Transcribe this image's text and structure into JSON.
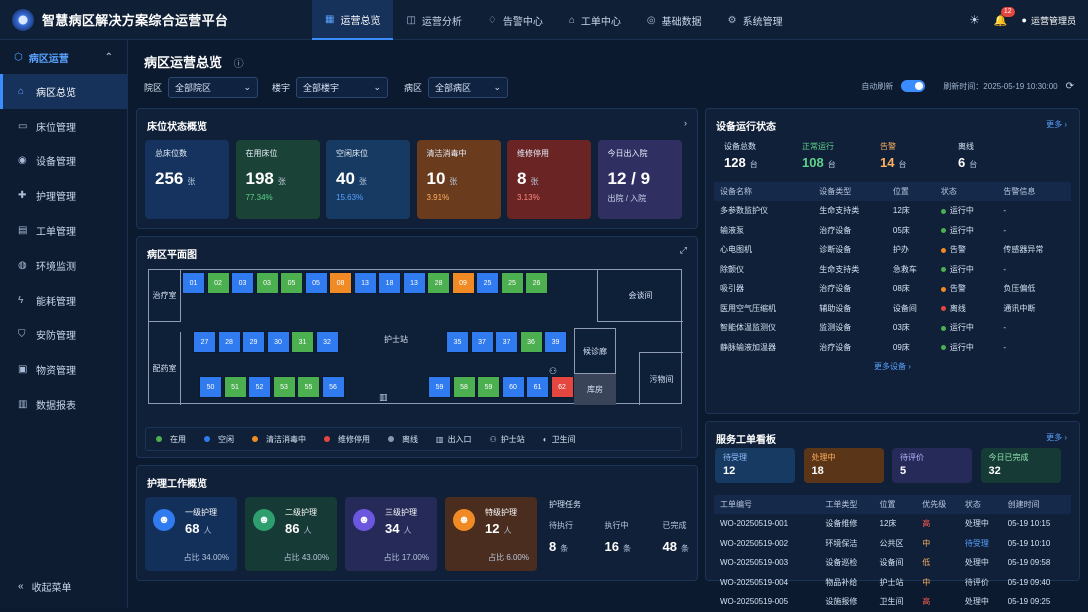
{
  "app": {
    "title": "智慧病区解决方案综合运营平台"
  },
  "topnav": [
    {
      "label": "运营总览",
      "icon": "grid-icon",
      "active": true
    },
    {
      "label": "运营分析",
      "icon": "chart-icon"
    },
    {
      "label": "告警中心",
      "icon": "bell-icon"
    },
    {
      "label": "工单中心",
      "icon": "home-icon"
    },
    {
      "label": "基础数据",
      "icon": "database-icon"
    },
    {
      "label": "系统管理",
      "icon": "gear-icon"
    }
  ],
  "header": {
    "notif_count": "12",
    "user": "运营管理员"
  },
  "sidebar": {
    "group": "病区运营",
    "items": [
      {
        "label": "病区总览",
        "icon": "home-icon",
        "active": true
      },
      {
        "label": "床位管理",
        "icon": "bed-icon"
      },
      {
        "label": "设备管理",
        "icon": "device-icon"
      },
      {
        "label": "护理管理",
        "icon": "care-icon"
      },
      {
        "label": "工单管理",
        "icon": "ticket-icon"
      },
      {
        "label": "环境监测",
        "icon": "env-icon"
      },
      {
        "label": "能耗管理",
        "icon": "energy-icon"
      },
      {
        "label": "安防管理",
        "icon": "shield-icon"
      },
      {
        "label": "物资管理",
        "icon": "box-icon"
      },
      {
        "label": "数据报表",
        "icon": "report-icon"
      }
    ],
    "collapse": "收起菜单"
  },
  "page": {
    "title": "病区运营总览"
  },
  "filters": {
    "campus_label": "院区",
    "campus_value": "全部院区",
    "building_label": "楼宇",
    "building_value": "全部楼宇",
    "ward_label": "病区",
    "ward_value": "全部病区",
    "auto_refresh": "自动刷新",
    "refresh_time": "刷新时间：2025-05-19 10:30:00"
  },
  "bed_status": {
    "title": "床位状态概览",
    "cards": [
      {
        "label": "总床位数",
        "value": "256",
        "unit": "张",
        "sub": "",
        "color": "#15335e",
        "subcolor": "#5aa2ff"
      },
      {
        "label": "在用床位",
        "value": "198",
        "unit": "张",
        "sub": "77.34%",
        "color": "#1b4236",
        "subcolor": "#5fd38a"
      },
      {
        "label": "空闲床位",
        "value": "40",
        "unit": "张",
        "sub": "15.63%",
        "color": "#173a62",
        "subcolor": "#5aa2ff"
      },
      {
        "label": "清洁消毒中",
        "value": "10",
        "unit": "张",
        "sub": "3.91%",
        "color": "#6a3b1c",
        "subcolor": "#ffb060"
      },
      {
        "label": "维修停用",
        "value": "8",
        "unit": "张",
        "sub": "3.13%",
        "color": "#6a2424",
        "subcolor": "#ff8a80"
      },
      {
        "label": "今日出入院",
        "value": "12 / 9",
        "unit": "",
        "sub": "出院 / 入院",
        "color": "#2f2f62",
        "subcolor": "#c9d6ea"
      }
    ]
  },
  "floorplan": {
    "title": "病区平面图",
    "rooms": {
      "treatment": "治疗室",
      "dispensary": "配药室",
      "nurse_station": "护士站",
      "reception": "会谈间",
      "corridor": "候诊廊",
      "storeroom": "库房",
      "dirty": "污物间"
    },
    "row1": [
      {
        "n": "01",
        "s": "idle"
      },
      {
        "n": "02",
        "s": "use"
      },
      {
        "n": "03",
        "s": "idle"
      },
      {
        "n": "03",
        "s": "use"
      },
      {
        "n": "05",
        "s": "use"
      },
      {
        "n": "05",
        "s": "idle"
      },
      {
        "n": "08",
        "s": "clean"
      },
      {
        "n": "13",
        "s": "idle"
      },
      {
        "n": "18",
        "s": "idle"
      },
      {
        "n": "13",
        "s": "idle"
      },
      {
        "n": "28",
        "s": "use"
      },
      {
        "n": "09",
        "s": "clean"
      },
      {
        "n": "25",
        "s": "idle"
      },
      {
        "n": "25",
        "s": "use"
      },
      {
        "n": "26",
        "s": "use"
      }
    ],
    "row2a": [
      {
        "n": "27",
        "s": "idle"
      },
      {
        "n": "28",
        "s": "idle"
      },
      {
        "n": "29",
        "s": "idle"
      },
      {
        "n": "30",
        "s": "idle"
      },
      {
        "n": "31",
        "s": "use"
      },
      {
        "n": "32",
        "s": "idle"
      }
    ],
    "row2b": [
      {
        "n": "35",
        "s": "idle"
      },
      {
        "n": "37",
        "s": "idle"
      },
      {
        "n": "37",
        "s": "idle"
      },
      {
        "n": "36",
        "s": "use"
      },
      {
        "n": "39",
        "s": "idle"
      }
    ],
    "row3a": [
      {
        "n": "50",
        "s": "idle"
      },
      {
        "n": "51",
        "s": "use"
      },
      {
        "n": "52",
        "s": "idle"
      },
      {
        "n": "53",
        "s": "use"
      },
      {
        "n": "55",
        "s": "use"
      },
      {
        "n": "56",
        "s": "idle"
      }
    ],
    "row3b": [
      {
        "n": "59",
        "s": "idle"
      },
      {
        "n": "58",
        "s": "use"
      },
      {
        "n": "59",
        "s": "use"
      },
      {
        "n": "60",
        "s": "idle"
      },
      {
        "n": "61",
        "s": "idle"
      },
      {
        "n": "62",
        "s": "repair"
      }
    ],
    "legend": [
      {
        "label": "在用",
        "color": "#4caf50"
      },
      {
        "label": "空闲",
        "color": "#2f7bef"
      },
      {
        "label": "清洁消毒中",
        "color": "#f08a24"
      },
      {
        "label": "维修停用",
        "color": "#e5463f"
      },
      {
        "label": "离线",
        "color": "#8a97ab"
      },
      {
        "label": "出入口",
        "icon": "exit-icon"
      },
      {
        "label": "护士站",
        "icon": "nurse-icon"
      },
      {
        "label": "卫生间",
        "icon": "toilet-icon"
      }
    ]
  },
  "nursing": {
    "title": "护理工作概览",
    "cards": [
      {
        "label": "一级护理",
        "value": "68",
        "unit": "人",
        "pct": "占比 34.00%",
        "color": "#13305a",
        "iconbg": "#2f7bef"
      },
      {
        "label": "二级护理",
        "value": "86",
        "unit": "人",
        "pct": "占比 43.00%",
        "color": "#163a35",
        "iconbg": "#2f9e6f"
      },
      {
        "label": "三级护理",
        "value": "34",
        "unit": "人",
        "pct": "占比 17.00%",
        "color": "#262a58",
        "iconbg": "#6c58e0"
      },
      {
        "label": "特级护理",
        "value": "12",
        "unit": "人",
        "pct": "占比 6.00%",
        "color": "#4a2d1e",
        "iconbg": "#f08a24"
      }
    ],
    "tasks": {
      "title": "护理任务",
      "items": [
        {
          "label": "待执行",
          "value": "8",
          "unit": "条"
        },
        {
          "label": "执行中",
          "value": "16",
          "unit": "条"
        },
        {
          "label": "已完成",
          "value": "48",
          "unit": "条"
        }
      ]
    }
  },
  "devices": {
    "title": "设备运行状态",
    "more": "更多 ›",
    "stats": [
      {
        "label": "设备总数",
        "value": "128",
        "unit": "台",
        "color": "#d6e2f3",
        "valcolor": "#fff"
      },
      {
        "label": "正常运行",
        "value": "108",
        "unit": "台",
        "color": "#5fd38a",
        "valcolor": "#5fd38a"
      },
      {
        "label": "告警",
        "value": "14",
        "unit": "台",
        "color": "#ffb060",
        "valcolor": "#ffb060"
      },
      {
        "label": "离线",
        "value": "6",
        "unit": "台",
        "color": "#d6e2f3",
        "valcolor": "#fff"
      }
    ],
    "columns": [
      "设备名称",
      "设备类型",
      "位置",
      "状态",
      "告警信息"
    ],
    "rows": [
      [
        "多参数监护仪",
        "生命支持类",
        "12床",
        "运行中",
        "-"
      ],
      [
        "输液泵",
        "治疗设备",
        "05床",
        "运行中",
        "-"
      ],
      [
        "心电图机",
        "诊断设备",
        "护办",
        "告警",
        "传感器异常"
      ],
      [
        "除颤仪",
        "生命支持类",
        "急救车",
        "运行中",
        "-"
      ],
      [
        "吸引器",
        "治疗设备",
        "08床",
        "告警",
        "负压偏低"
      ],
      [
        "医用空气压缩机",
        "辅助设备",
        "设备间",
        "离线",
        "通讯中断"
      ],
      [
        "智能体温监测仪",
        "监测设备",
        "03床",
        "运行中",
        "-"
      ],
      [
        "静脉输液加温器",
        "治疗设备",
        "09床",
        "运行中",
        "-"
      ]
    ],
    "status_colors": {
      "运行中": "#4caf50",
      "告警": "#f08a24",
      "离线": "#e5463f"
    },
    "more_devices": "更多设备 ›"
  },
  "workorders": {
    "title": "服务工单看板",
    "more": "更多 ›",
    "cards": [
      {
        "label": "待受理",
        "value": "12",
        "color": "#173a62",
        "labelcolor": "#8fc0ff"
      },
      {
        "label": "处理中",
        "value": "18",
        "color": "#5a3518",
        "labelcolor": "#ffb060"
      },
      {
        "label": "待评价",
        "value": "5",
        "color": "#262a58",
        "labelcolor": "#b8b4ff"
      },
      {
        "label": "今日已完成",
        "value": "32",
        "color": "#163a35",
        "labelcolor": "#8fe3b0"
      }
    ],
    "columns": [
      "工单编号",
      "工单类型",
      "位置",
      "优先级",
      "状态",
      "创建时间"
    ],
    "rows": [
      [
        "WO-20250519-001",
        "设备维修",
        "12床",
        "高",
        "处理中",
        "05-19 10:15"
      ],
      [
        "WO-20250519-002",
        "环境保洁",
        "公共区",
        "中",
        "待受理",
        "05-19 10:10"
      ],
      [
        "WO-20250519-003",
        "设备巡检",
        "设备间",
        "低",
        "处理中",
        "05-19 09:58"
      ],
      [
        "WO-20250519-004",
        "物品补给",
        "护士站",
        "中",
        "待评价",
        "05-19 09:40"
      ],
      [
        "WO-20250519-005",
        "设施报修",
        "卫生间",
        "高",
        "处理中",
        "05-19 09:25"
      ]
    ],
    "priority_colors": {
      "高": "#ff5a4f",
      "中": "#ffb060",
      "低": "#ffb060"
    },
    "status_colors": {
      "处理中": "#d6e2f3",
      "待受理": "#5aa2ff",
      "待评价": "#d6e2f3"
    }
  }
}
